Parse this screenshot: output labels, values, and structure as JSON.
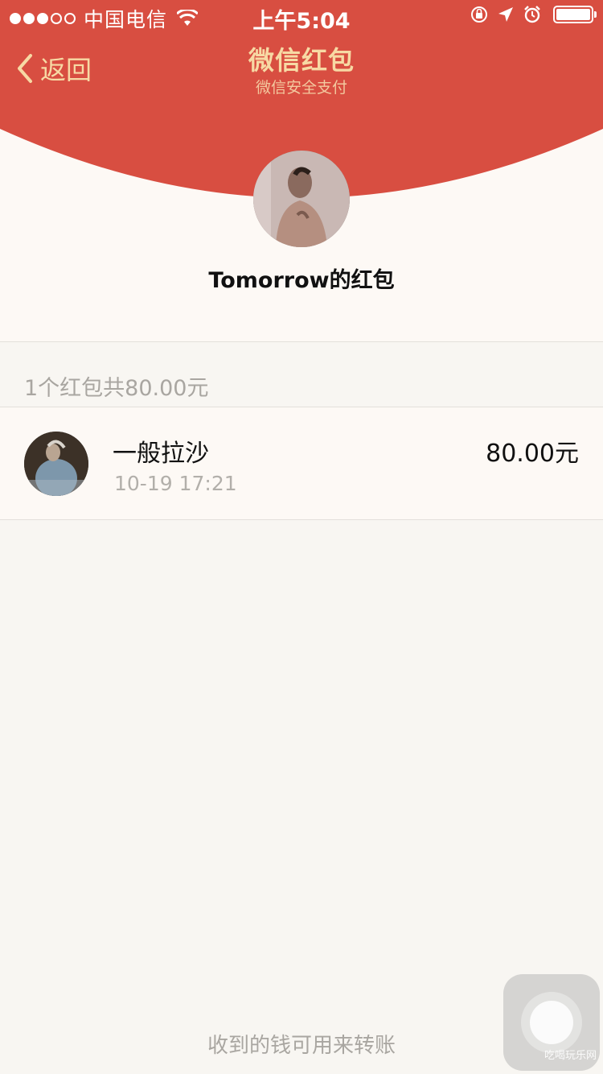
{
  "status_bar": {
    "carrier": "中国电信",
    "time": "上午5:04",
    "signal_bars_filled": 3,
    "signal_bars_total": 5
  },
  "nav": {
    "back_label": "返回",
    "title": "微信红包",
    "subtitle": "微信安全支付"
  },
  "colors": {
    "header_red": "#d84e41",
    "title_gold": "#f7d9a4",
    "page_bg": "#f8f6f2"
  },
  "sender": {
    "title": "Tomorrow的红包"
  },
  "summary": {
    "text": "1个红包共80.00元"
  },
  "receivers": [
    {
      "name": "一般拉沙",
      "time": "10-19 17:21",
      "amount": "80.00元"
    }
  ],
  "footer": {
    "link_text": "收到的钱可用来转账"
  },
  "watermark": "吃喝玩乐网"
}
